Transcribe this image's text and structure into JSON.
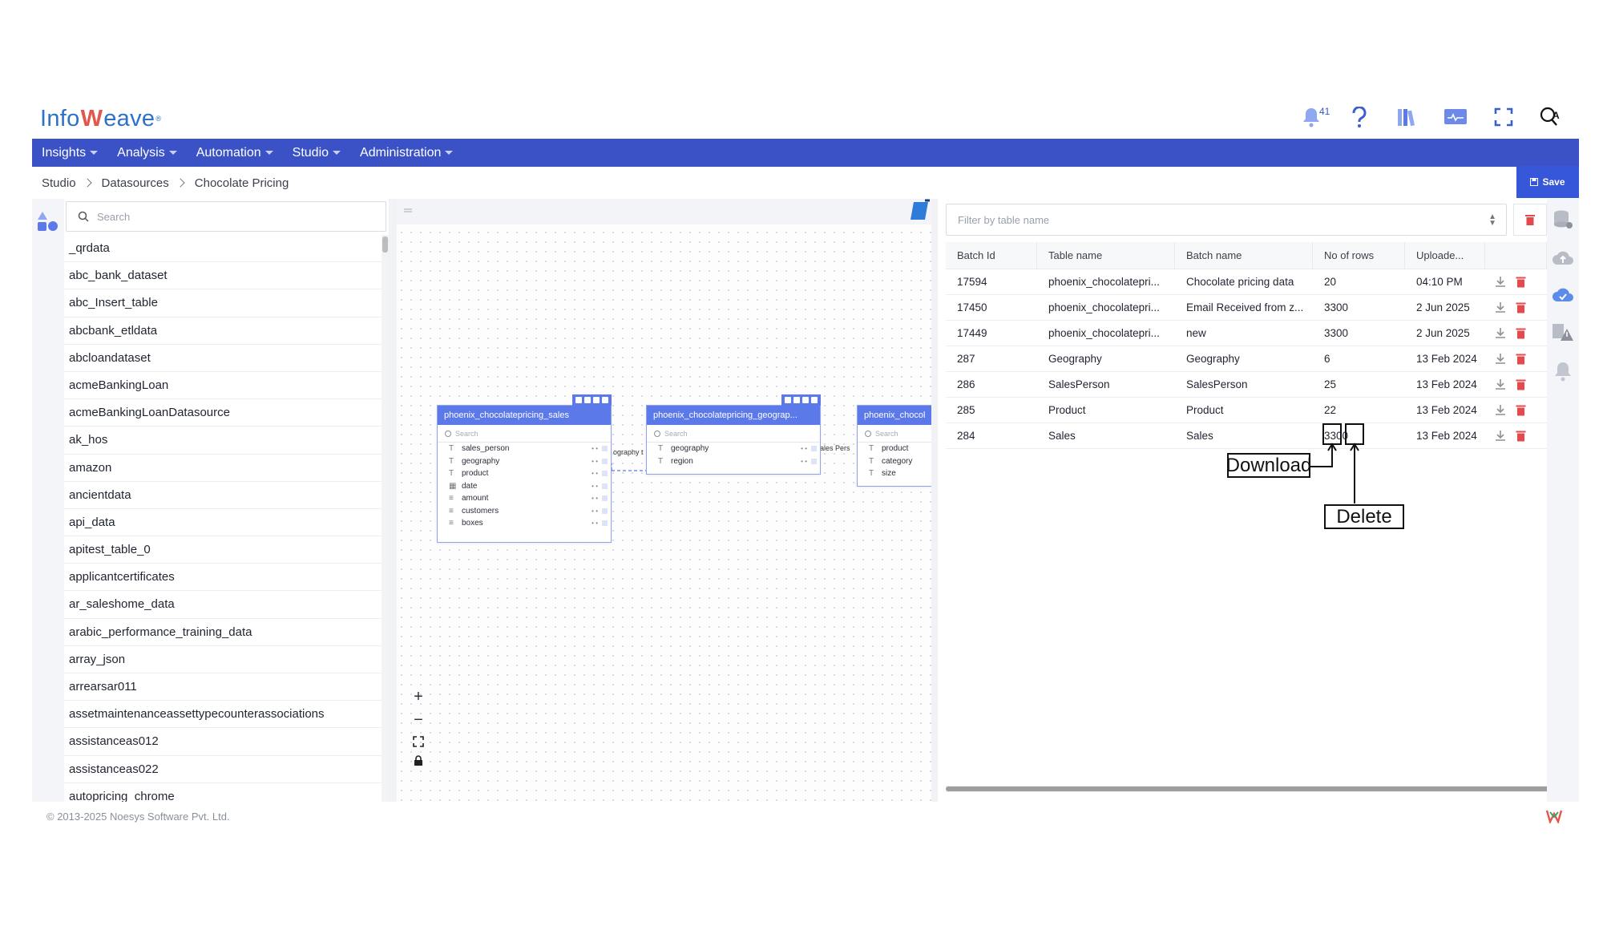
{
  "brand": {
    "logo_prefix": "Info",
    "logo_w": "W",
    "logo_suffix": "eave",
    "logo_reg": "®"
  },
  "header": {
    "notifications_count": "41"
  },
  "menu": [
    {
      "label": "Insights"
    },
    {
      "label": "Analysis"
    },
    {
      "label": "Automation"
    },
    {
      "label": "Studio"
    },
    {
      "label": "Administration"
    }
  ],
  "breadcrumb": [
    "Studio",
    "Datasources",
    "Chocolate Pricing"
  ],
  "toolbar": {
    "save_label": "Save"
  },
  "left_panel": {
    "search_placeholder": "Search",
    "items": [
      "_qrdata",
      "abc_bank_dataset",
      "abc_Insert_table",
      "abcbank_etldata",
      "abcloandataset",
      "acmeBankingLoan",
      "acmeBankingLoanDatasource",
      "ak_hos",
      "amazon",
      "ancientdata",
      "api_data",
      "apitest_table_0",
      "applicantcertificates",
      "ar_saleshome_data",
      "arabic_performance_training_data",
      "array_json",
      "arrearsar011",
      "assetmaintenanceassettypecounterassociations",
      "assistanceas012",
      "assistanceas022",
      "autopricing_chrome"
    ]
  },
  "canvas": {
    "nodes": [
      {
        "title": "phoenix_chocolatepricing_sales",
        "search": "Search",
        "columns": [
          {
            "type": "T",
            "name": "sales_person"
          },
          {
            "type": "T",
            "name": "geography"
          },
          {
            "type": "T",
            "name": "product"
          },
          {
            "type": "▦",
            "name": "date"
          },
          {
            "type": "≡",
            "name": "amount"
          },
          {
            "type": "≡",
            "name": "customers"
          },
          {
            "type": "≡",
            "name": "boxes"
          }
        ]
      },
      {
        "title": "phoenix_chocolatepricing_geograp...",
        "search": "Search",
        "columns": [
          {
            "type": "T",
            "name": "geography"
          },
          {
            "type": "T",
            "name": "region"
          }
        ]
      },
      {
        "title": "phoenix_chocol",
        "search": "Search",
        "columns": [
          {
            "type": "T",
            "name": "product"
          },
          {
            "type": "T",
            "name": "category"
          },
          {
            "type": "T",
            "name": "size"
          }
        ]
      }
    ],
    "link_labels": [
      "ography t",
      "ales Pers"
    ]
  },
  "right_panel": {
    "filter_placeholder": "Filter by table name",
    "columns": [
      "Batch Id",
      "Table name",
      "Batch name",
      "No of rows",
      "Uploade..."
    ],
    "rows": [
      {
        "batch_id": "17594",
        "table": "phoenix_chocolatepri...",
        "batch": "Chocolate pricing data",
        "rows": "20",
        "uploaded": "04:10 PM"
      },
      {
        "batch_id": "17450",
        "table": "phoenix_chocolatepri...",
        "batch": "Email Received from z...",
        "rows": "3300",
        "uploaded": "2 Jun 2025"
      },
      {
        "batch_id": "17449",
        "table": "phoenix_chocolatepri...",
        "batch": "new",
        "rows": "3300",
        "uploaded": "2 Jun 2025"
      },
      {
        "batch_id": "287",
        "table": "Geography",
        "batch": "Geography",
        "rows": "6",
        "uploaded": "13 Feb 2024"
      },
      {
        "batch_id": "286",
        "table": "SalesPerson",
        "batch": "SalesPerson",
        "rows": "25",
        "uploaded": "13 Feb 2024"
      },
      {
        "batch_id": "285",
        "table": "Product",
        "batch": "Product",
        "rows": "22",
        "uploaded": "13 Feb 2024"
      },
      {
        "batch_id": "284",
        "table": "Sales",
        "batch": "Sales",
        "rows": "3300",
        "uploaded": "13 Feb 2024"
      }
    ]
  },
  "annotations": {
    "download": "Download",
    "delete": "Delete"
  },
  "footer": {
    "copyright": "© 2013-2025 Noesys Software Pvt. Ltd."
  },
  "colors": {
    "primary": "#3a52c6",
    "accent": "#3657d9",
    "delete_red": "#e5484d",
    "node_header": "#5b79e8"
  }
}
